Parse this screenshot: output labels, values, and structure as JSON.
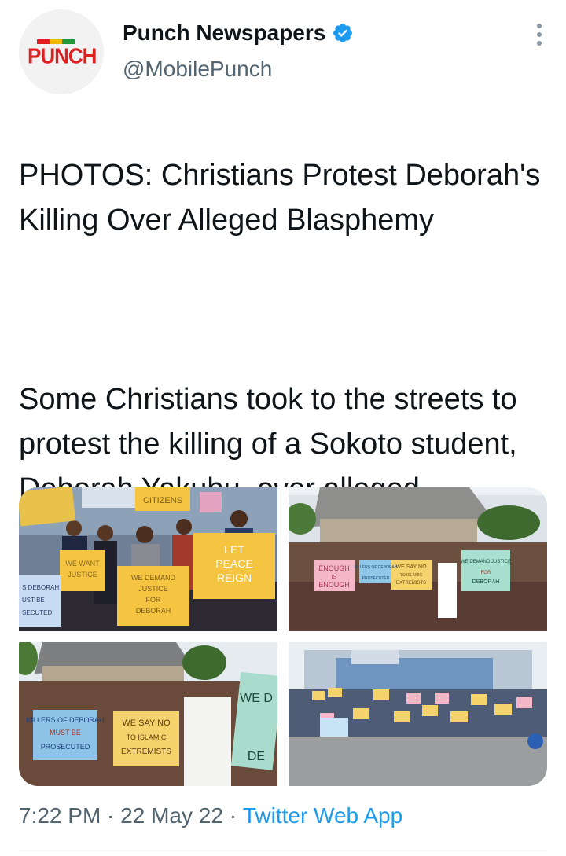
{
  "author": {
    "display_name": "Punch Newspapers",
    "handle": "@MobilePunch",
    "avatar_logo_text": "PUNCH",
    "verified": true,
    "verified_icon": "verified-badge-icon"
  },
  "tweet": {
    "headline": "PHOTOS: Christians Protest Deborah's Killing Over Alleged Blasphemy",
    "body": "Some Christians took to the streets to protest the killing of a Sokoto student, Deborah Yakubu, over alleged blasphemy."
  },
  "photos": [
    {
      "signs": [
        "CITIZENS",
        "WE WANT JUSTICE",
        "WE DEMAND JUSTICE FOR DEBORAH",
        "LET PEACE REIGN",
        "...S DEBORAH ...UST BE ...SECUTED"
      ]
    },
    {
      "signs": [
        "ENOUGH IS ENOUGH",
        "KILLERS OF DEBORAH MUST BE PROSECUTED",
        "WE SAY NO TO ISLAMIC EXTREMISTS",
        "WE DEMAND JUSTICE FOR DEBORAH"
      ]
    },
    {
      "signs": [
        "KILLERS OF DEBORAH MUST BE PROSECUTED",
        "WE SAY NO TO ISLAMIC EXTREMISTS",
        "WE D... DE..."
      ]
    },
    {
      "signs": []
    }
  ],
  "meta": {
    "time": "7:22 PM",
    "separator": " · ",
    "date": "22 May 22",
    "source": "Twitter Web App"
  },
  "colors": {
    "accent": "#1d9bf0",
    "secondary_text": "#536471",
    "logo_red": "#e02020"
  }
}
